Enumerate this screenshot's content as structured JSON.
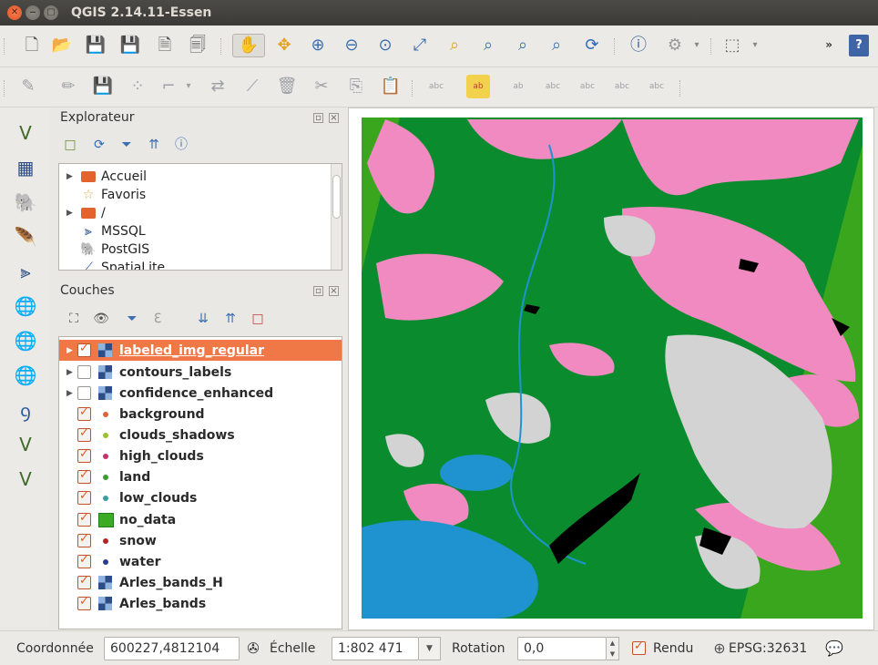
{
  "window": {
    "title": "QGIS 2.14.11-Essen"
  },
  "toolbar_overflow": "»",
  "help_label": "?",
  "browser_panel": {
    "title": "Explorateur",
    "items": [
      {
        "label": "Accueil",
        "icon": "folder-icon",
        "expandable": true
      },
      {
        "label": "Favoris",
        "icon": "star-icon",
        "expandable": false
      },
      {
        "label": "/",
        "icon": "folder-icon",
        "expandable": true
      },
      {
        "label": "MSSQL",
        "icon": "mssql-icon",
        "expandable": false
      },
      {
        "label": "PostGIS",
        "icon": "postgis-icon",
        "expandable": false
      },
      {
        "label": "SpatiaLite",
        "icon": "spatialite-icon",
        "expandable": false
      }
    ]
  },
  "layers_panel": {
    "title": "Couches",
    "layers": [
      {
        "name": "labeled_img_regular",
        "kind": "raster",
        "checked": true,
        "expandable": true,
        "selected": true
      },
      {
        "name": "contours_labels",
        "kind": "raster",
        "checked": false,
        "expandable": true
      },
      {
        "name": "confidence_enhanced",
        "kind": "raster",
        "checked": false,
        "expandable": true
      },
      {
        "name": "background",
        "kind": "dot",
        "color": "#e0613a",
        "checked": true
      },
      {
        "name": "clouds_shadows",
        "kind": "dot",
        "color": "#9ac32a",
        "checked": true
      },
      {
        "name": "high_clouds",
        "kind": "dot",
        "color": "#c0336d",
        "checked": true
      },
      {
        "name": "land",
        "kind": "dot",
        "color": "#3c9a31",
        "checked": true
      },
      {
        "name": "low_clouds",
        "kind": "dot",
        "color": "#3c9ea3",
        "checked": true
      },
      {
        "name": "no_data",
        "kind": "square",
        "color": "#3cab23",
        "checked": true
      },
      {
        "name": "snow",
        "kind": "dot",
        "color": "#b52424",
        "checked": true
      },
      {
        "name": "water",
        "kind": "dot",
        "color": "#263e8c",
        "checked": true
      },
      {
        "name": "Arles_bands_H",
        "kind": "raster",
        "checked": true
      },
      {
        "name": "Arles_bands",
        "kind": "raster",
        "checked": true
      }
    ]
  },
  "map_colors": {
    "no_data": "#3aa61e",
    "land": "#0a8c2e",
    "high_clouds": "#f08ac0",
    "low_clouds": "#d3d3d3",
    "water": "#1f93d0",
    "shadows": "#000000"
  },
  "statusbar": {
    "coord_label": "Coordonnée",
    "coord_value": "600227,4812104",
    "scale_label": "Échelle",
    "scale_value": "1:802 471",
    "rotation_label": "Rotation",
    "rotation_value": "0,0",
    "render_label": "Rendu",
    "render_checked": true,
    "crs_label": "EPSG:32631"
  }
}
